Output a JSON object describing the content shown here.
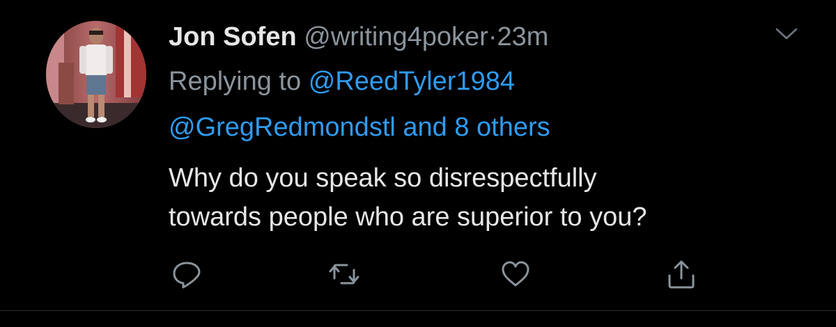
{
  "tweet": {
    "display_name": "Jon Sofen",
    "handle": "@writing4poker",
    "separator": "·",
    "timestamp": "23m",
    "replying_prefix": "Replying to",
    "replying_to_user": "@ReedTyler1984",
    "replying_to_second": "@GregRedmondstl",
    "replying_and": "and",
    "replying_others": "8 others",
    "body_line_1": "Why do you speak so disrespectfully",
    "body_line_2": "towards people who are superior to you?"
  },
  "actions": {
    "reply_icon": "reply-icon",
    "retweet_icon": "retweet-icon",
    "like_icon": "heart-icon",
    "share_icon": "share-icon",
    "menu_icon": "chevron-down-icon"
  },
  "colors": {
    "background": "#000000",
    "name": "#e7e7e7",
    "muted": "#8b949c",
    "link": "#2f9bf0",
    "icon": "#8b949c",
    "divider": "#2a2e31"
  }
}
